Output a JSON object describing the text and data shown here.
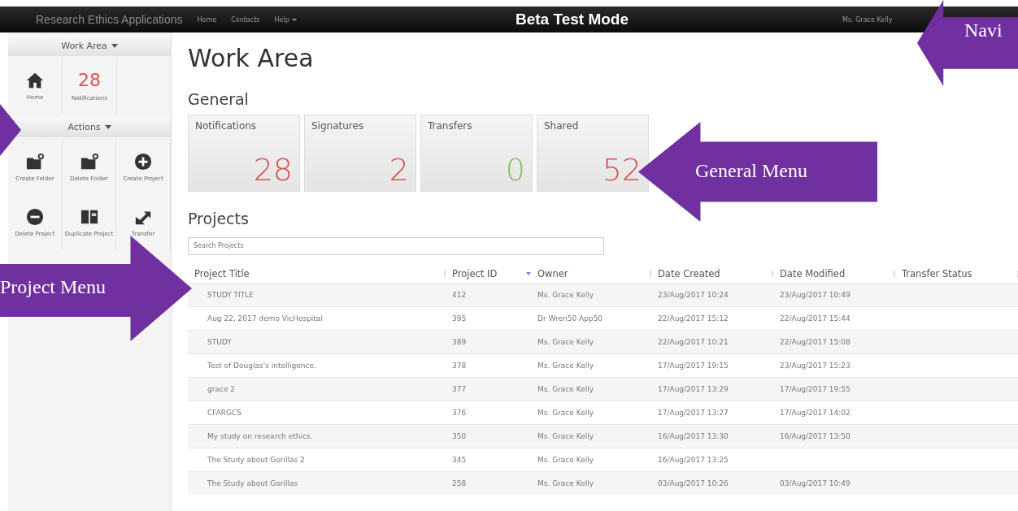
{
  "navbar": {
    "brand": "Research Ethics Applications",
    "links": [
      {
        "label": "Home",
        "dropdown": false
      },
      {
        "label": "Contacts",
        "dropdown": false
      },
      {
        "label": "Help",
        "dropdown": true
      }
    ],
    "mode": "Beta Test Mode",
    "user": "Ms. Grace Kelly"
  },
  "sidebar": {
    "sections": [
      {
        "title": "Work Area",
        "rows": [
          [
            {
              "kind": "icon",
              "label": "Home"
            },
            {
              "kind": "count",
              "count": "28",
              "label": "Notifications"
            }
          ]
        ]
      },
      {
        "title": "Actions",
        "rows": [
          [
            {
              "kind": "icon",
              "label": "Create Folder"
            },
            {
              "kind": "icon",
              "label": "Delete Folder"
            },
            {
              "kind": "icon",
              "label": "Create Project"
            }
          ],
          [
            {
              "kind": "icon",
              "label": "Delete Project"
            },
            {
              "kind": "icon",
              "label": "Duplicate Project"
            },
            {
              "kind": "icon",
              "label": "Transfer"
            }
          ]
        ]
      }
    ]
  },
  "page_title": "Work Area",
  "general": {
    "heading": "General",
    "cards": [
      {
        "label": "Notifications",
        "value": "28",
        "color": "#d9534f"
      },
      {
        "label": "Signatures",
        "value": "2",
        "color": "#d9534f"
      },
      {
        "label": "Transfers",
        "value": "0",
        "color": "#8fbc6a"
      },
      {
        "label": "Shared",
        "value": "52",
        "color": "#d9534f"
      }
    ]
  },
  "projects": {
    "heading": "Projects",
    "search": {
      "placeholder": "Search Projects"
    },
    "columns": [
      {
        "label": "Project Title",
        "sorted": false
      },
      {
        "label": "Project ID",
        "sorted": true
      },
      {
        "label": "Owner",
        "sorted": false
      },
      {
        "label": "Date Created",
        "sorted": false
      },
      {
        "label": "Date Modified",
        "sorted": false
      },
      {
        "label": "Transfer Status",
        "sorted": false
      }
    ],
    "rows": [
      {
        "cells": [
          "STUDY TITLE",
          "412",
          "Ms. Grace Kelly",
          "23/Aug/2017 10:24",
          "23/Aug/2017 10:49"
        ]
      },
      {
        "cells": [
          "Aug 22, 2017 demo VicHospital",
          "395",
          "Dr Wren50 App50",
          "22/Aug/2017 15:12",
          "22/Aug/2017 15:44"
        ]
      },
      {
        "cells": [
          "STUDY",
          "389",
          "Ms. Grace Kelly",
          "22/Aug/2017 10:21",
          "22/Aug/2017 15:08"
        ]
      },
      {
        "cells": [
          "Test of Douglas's intelligence.",
          "378",
          "Ms. Grace Kelly",
          "17/Aug/2017 19:15",
          "23/Aug/2017 15:23"
        ]
      },
      {
        "cells": [
          "grace 2",
          "377",
          "Ms. Grace Kelly",
          "17/Aug/2017 13:29",
          "17/Aug/2017 19:55"
        ]
      },
      {
        "cells": [
          "CFARGCS",
          "376",
          "Ms. Grace Kelly",
          "17/Aug/2017 13:27",
          "17/Aug/2017 14:02"
        ]
      },
      {
        "cells": [
          "My study on research ethics.",
          "350",
          "Ms. Grace Kelly",
          "16/Aug/2017 13:30",
          "16/Aug/2017 13:50"
        ]
      },
      {
        "cells": [
          "The Study about Gorillas 2",
          "345",
          "Ms. Grace Kelly",
          "16/Aug/2017 13:25"
        ]
      },
      {
        "cells": [
          "The Study about Gorillas",
          "258",
          "Ms. Grace Kelly",
          "03/Aug/2017 10:26",
          "03/Aug/2017 10:49"
        ]
      }
    ]
  },
  "callouts": [
    {
      "kind": "left",
      "text": "Navi"
    },
    {
      "kind": "left",
      "text": "General Menu"
    },
    {
      "kind": "right",
      "text": "Project Menu"
    },
    {
      "kind": "tip"
    }
  ]
}
